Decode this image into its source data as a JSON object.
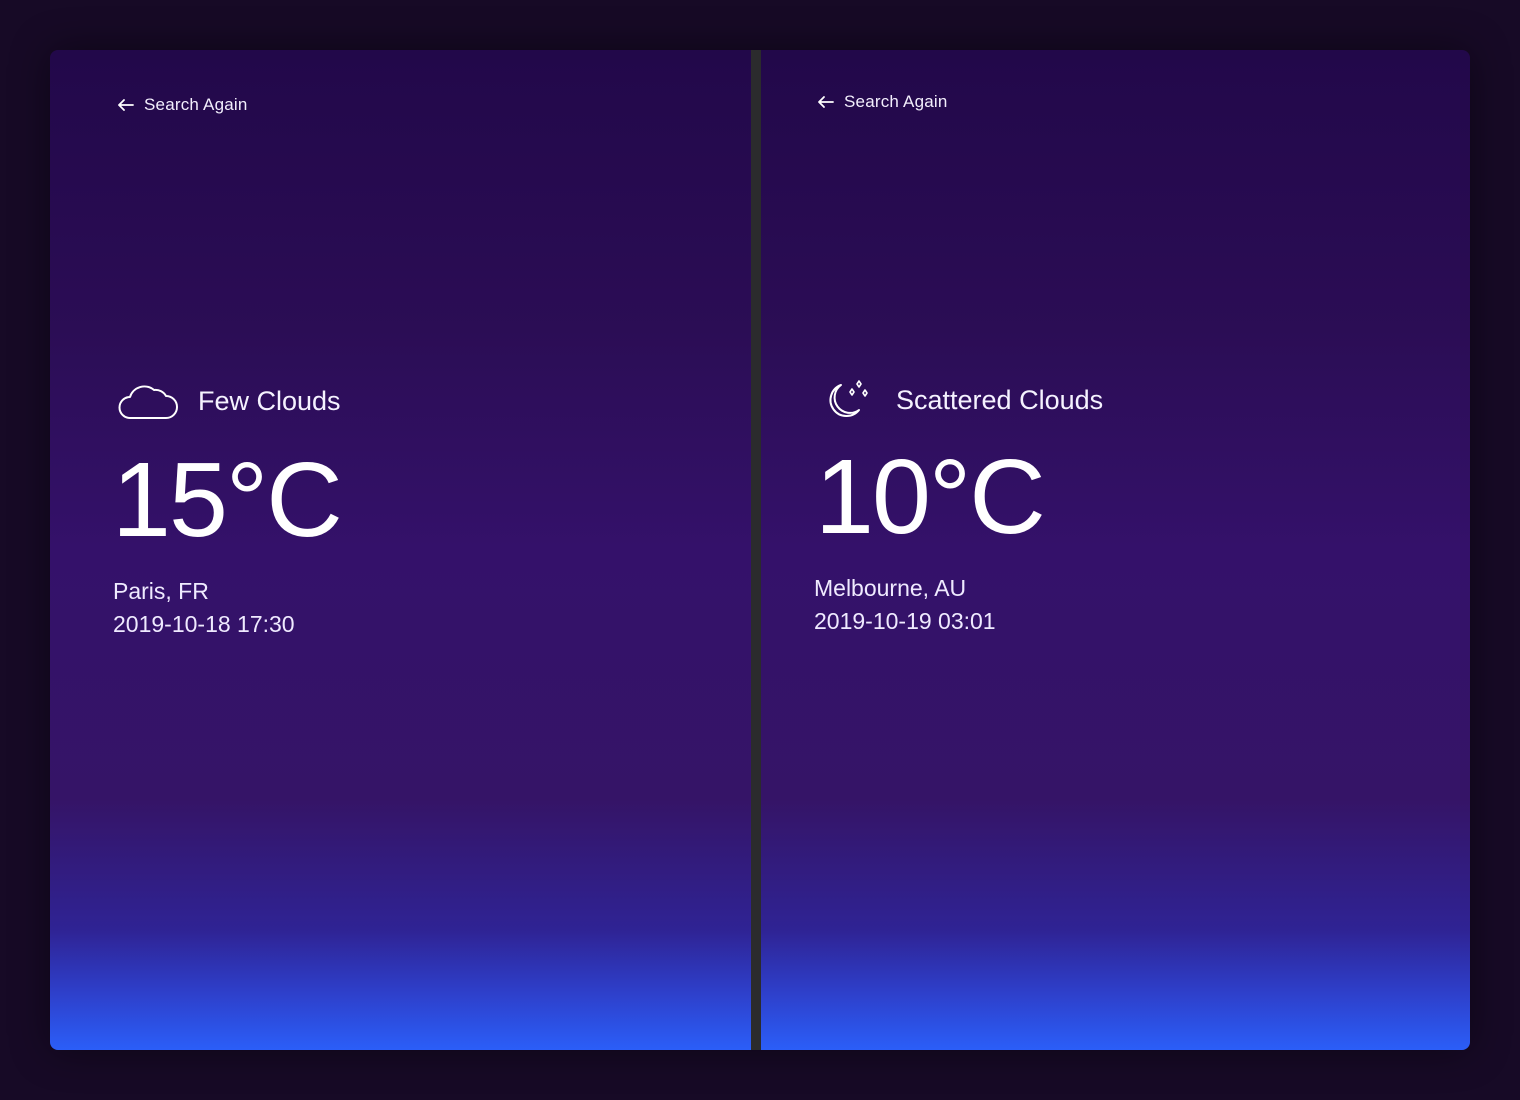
{
  "panels": [
    {
      "back_label": "Search Again",
      "condition": "Few Clouds",
      "condition_icon": "cloud-icon",
      "temperature": "15°C",
      "location": "Paris, FR",
      "datetime": "2019-10-18 17:30"
    },
    {
      "back_label": "Search Again",
      "condition": "Scattered Clouds",
      "condition_icon": "moon-stars-icon",
      "temperature": "10°C",
      "location": "Melbourne, AU",
      "datetime": "2019-10-19 03:01"
    }
  ],
  "colors": {
    "page_background": "#170a26",
    "gradient_top": "#22084a",
    "gradient_mid": "#34116a",
    "gradient_bottom": "#2b5ef8",
    "divider": "#2b2b2d",
    "text": "#ffffff"
  }
}
